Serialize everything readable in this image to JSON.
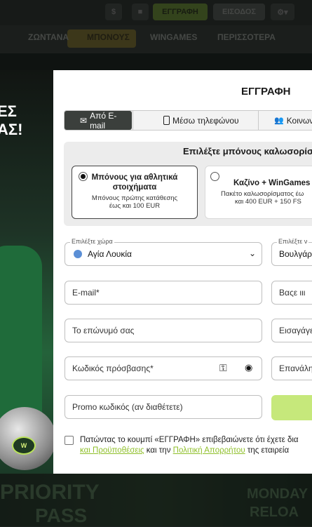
{
  "topbar": {
    "register_label": "ΕΓΓΡΑΦΗ",
    "login_label": "ΕΙΣΟΔΟΣ"
  },
  "nav": {
    "items": [
      "ΖΩΝΤΑΝΑ",
      "ΜΠΟΝΟΥΣ",
      "WINGAMES",
      "ΠΕΡΙΣΣΟΤΕΡΑ"
    ]
  },
  "hero": {
    "line1": "ΕΣ",
    "line2": "ΑΣ!",
    "badge": "W"
  },
  "bottom_banner": {
    "left_line1": "PRIORITY",
    "left_line2": "PASS",
    "right_line1": "MONDAY",
    "right_line2": "RELOA"
  },
  "modal": {
    "title": "ΕΓΓΡΑΦΗ",
    "tabs": [
      {
        "label": "Από E-mail",
        "active": true,
        "icon": "envelope-icon"
      },
      {
        "label": "Μέσω τηλεφώνου",
        "active": false,
        "icon": "phone-icon"
      },
      {
        "label": "Κοινων",
        "active": false,
        "icon": "users-icon"
      }
    ],
    "bonus": {
      "title": "Επιλέξτε μπόνους καλωσορίσ",
      "cards": [
        {
          "title_line1": "Μπόνους για αθλητικά",
          "title_line2": "στοιχήματα",
          "desc_line1": "Μπόνους πρώτης κατάθεσης",
          "desc_line2": "έως και 100 EUR",
          "selected": true
        },
        {
          "title_line1": "Καζίνο + WinGames",
          "title_line2": "",
          "desc_line1": "Πακέτο καλωσορίσματος έω",
          "desc_line2": "και 400 EUR + 150 FS",
          "selected": false
        }
      ]
    },
    "fields": {
      "country_label": "Επιλέξτε χώρα",
      "country_value": "Αγία Λουκία",
      "currency_label": "Επιλέξτε ν",
      "currency_value": "Βουλγάρ",
      "email": "E-mail*",
      "username": "Βαςε ιιι",
      "surname": "Το επώνυμό σας",
      "name_hint": "Εισαγάγε",
      "password": "Κωδικός πρόσβασης*",
      "repeat": "Επανάλη",
      "promo": "Promo κωδικός (αν διαθέτετε)"
    },
    "terms": {
      "line1": "Πατώντας το κουμπί «ΕΓΓΡΑΦΗ» επιβεβαιώνετε ότι έχετε δια",
      "link1": "και Προϋποθέσεις",
      "mid": " και την ",
      "link2": "Πολιτική Απορρήτου",
      "end": " της εταιρεία"
    }
  },
  "colors": {
    "accent": "#c6e87b",
    "link": "#8fbf2a",
    "tab_active": "#3b3f3c"
  }
}
